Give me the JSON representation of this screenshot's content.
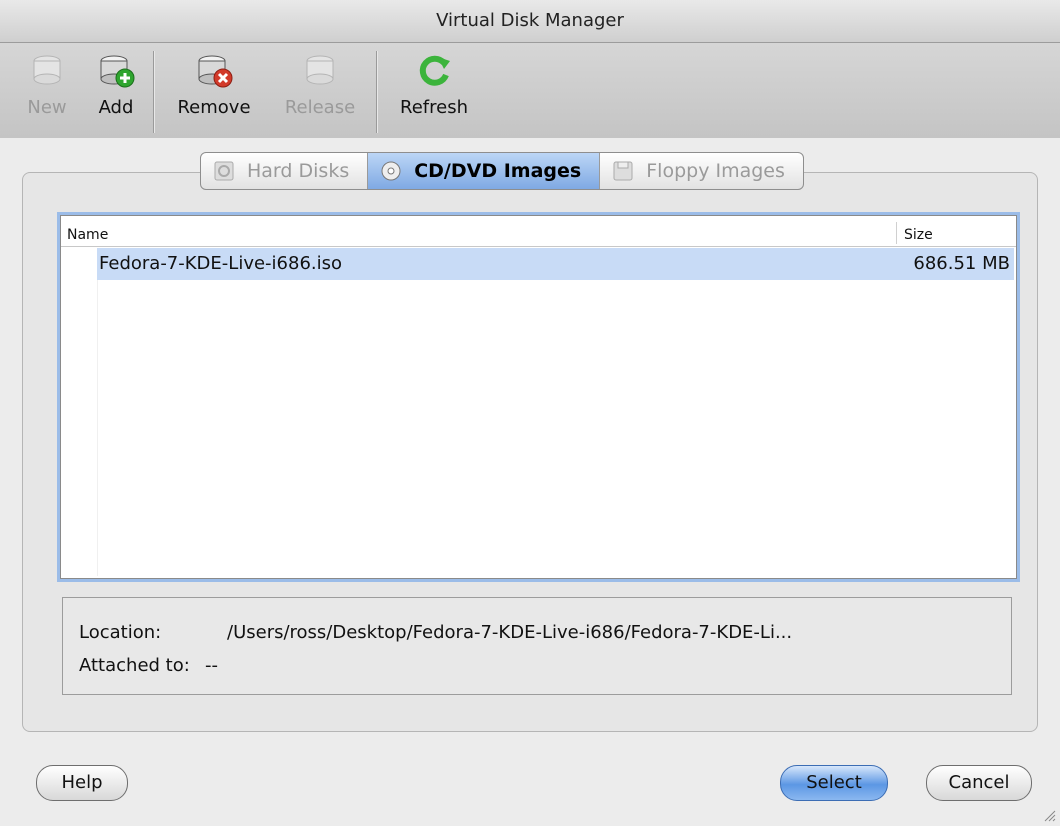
{
  "window": {
    "title": "Virtual Disk Manager"
  },
  "toolbar": {
    "new_label": "New",
    "add_label": "Add",
    "remove_label": "Remove",
    "release_label": "Release",
    "refresh_label": "Refresh"
  },
  "tabs": [
    {
      "label": "Hard Disks",
      "icon": "hard-disk-icon",
      "active": false
    },
    {
      "label": "CD/DVD Images",
      "icon": "cd-icon",
      "active": true
    },
    {
      "label": "Floppy Images",
      "icon": "floppy-icon",
      "active": false
    }
  ],
  "list": {
    "columns": {
      "name": "Name",
      "size": "Size"
    },
    "rows": [
      {
        "name": "Fedora-7-KDE-Live-i686.iso",
        "size": "686.51 MB",
        "selected": true
      }
    ]
  },
  "info": {
    "location_label": "Location:",
    "location_value": "/Users/ross/Desktop/Fedora-7-KDE-Live-i686/Fedora-7-KDE-Li...",
    "attached_label": "Attached to:",
    "attached_value": "--"
  },
  "buttons": {
    "help_label": "Help",
    "select_label": "Select",
    "cancel_label": "Cancel"
  },
  "colors": {
    "selection": "#c8dbf6",
    "focus_ring": "#9bbce8",
    "refresh_green": "#3cb43c",
    "add_green": "#2fa52f",
    "remove_red": "#d23a2a"
  }
}
